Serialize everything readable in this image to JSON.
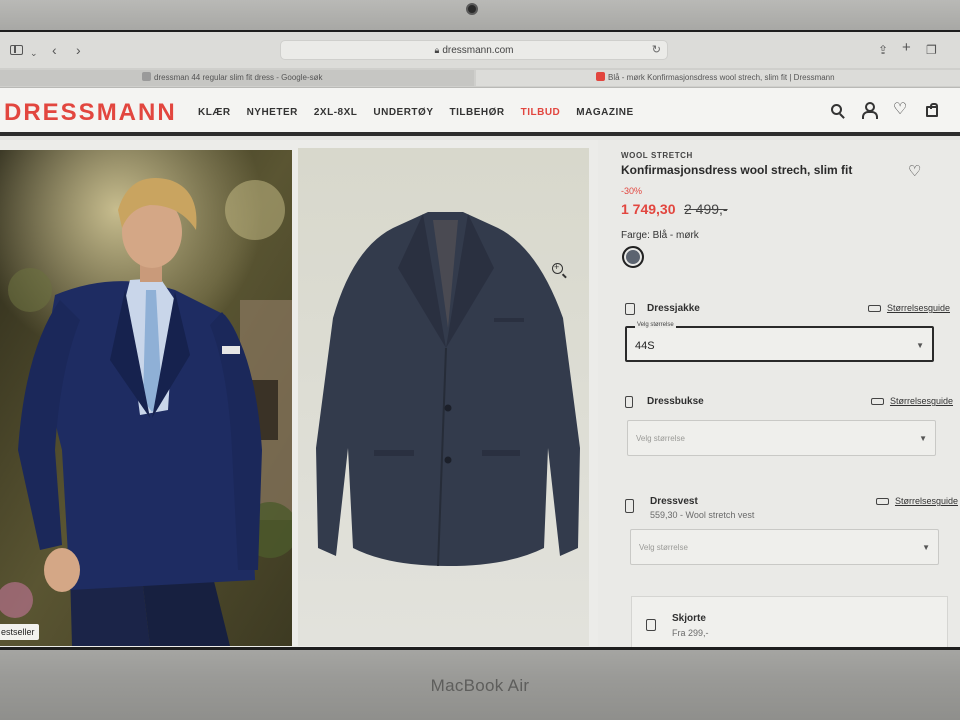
{
  "device": {
    "label": "MacBook Air"
  },
  "browser": {
    "url": "dressmann.com",
    "tabs": [
      {
        "label": "dressman 44 regular slim fit dress - Google-søk",
        "favicon_color": "#9a9a9a"
      },
      {
        "label": "Blå - mørk Konfirmasjonsdress wool strech, slim fit | Dressmann",
        "favicon_color": "#e2463f"
      }
    ]
  },
  "site": {
    "logo": "DRESSMANN",
    "brand_color": "#e2463f",
    "nav": [
      "KLÆR",
      "NYHETER",
      "2XL-8XL",
      "UNDERTØY",
      "TILBEHØR",
      "TILBUD",
      "MAGAZINE"
    ],
    "sale_nav_item": "TILBUD",
    "header_icons": [
      "search-icon",
      "account-icon",
      "wishlist-icon",
      "cart-icon"
    ]
  },
  "gallery": {
    "badge": "estseller"
  },
  "product": {
    "brand_line": "WOOL STRETCH",
    "title": "Konfirmasjonsdress wool strech, slim fit",
    "discount": "-30%",
    "price_now": "1 749,30",
    "price_old": "2 499,-",
    "color_label": "Farge: Blå - mørk",
    "swatch_color": "#5c6470"
  },
  "sections": {
    "jacket": {
      "title": "Dressjakke",
      "guide": "Størrelsesguide",
      "select_label": "Velg størrelse",
      "value": "44S"
    },
    "trousers": {
      "title": "Dressbukse",
      "guide": "Størrelsesguide",
      "placeholder": "Velg størrelse"
    },
    "vest": {
      "title": "Dressvest",
      "subtitle": "559,30 - Wool stretch vest",
      "guide": "Størrelsesguide",
      "placeholder": "Velg størrelse"
    },
    "shirt": {
      "title": "Skjorte",
      "subtitle": "Fra 299,-"
    }
  }
}
